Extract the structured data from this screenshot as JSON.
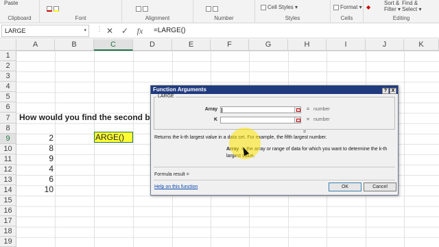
{
  "ribbon": {
    "paste_label": "Paste",
    "groups": [
      {
        "label": "Clipboard"
      },
      {
        "label": "Font"
      },
      {
        "label": "Alignment"
      },
      {
        "label": "Number"
      },
      {
        "label": "Styles"
      },
      {
        "label": "Cells"
      },
      {
        "label": "Editing"
      }
    ],
    "cell_styles_label": "Cell Styles",
    "format_label": "Format",
    "sort_filter_label": "Sort &",
    "filter_label": "Filter",
    "find_select_label": "Find &",
    "select_label": "Select"
  },
  "formula_bar": {
    "name_box": "LARGE",
    "formula": "=LARGE()",
    "cancel_icon": "close-icon",
    "enter_icon": "check-icon",
    "fx_label": "fx"
  },
  "grid": {
    "columns": [
      "A",
      "B",
      "C",
      "D",
      "E",
      "F",
      "G",
      "H",
      "I",
      "J",
      "K"
    ],
    "rows": [
      "1",
      "2",
      "3",
      "4",
      "5",
      "6",
      "7",
      "8",
      "9",
      "10",
      "11",
      "12",
      "13",
      "14",
      "15",
      "16",
      "17",
      "18",
      "19"
    ],
    "selected_column": "C",
    "selected_row": "9",
    "question": "How would you find the second b",
    "values": [
      "2",
      "8",
      "9",
      "4",
      "6",
      "10"
    ],
    "active_cell_text": "ARGE()"
  },
  "dialog": {
    "title": "Function Arguments",
    "help_btn": "?",
    "close_btn": "X",
    "function_name": "LARGE",
    "args": [
      {
        "label": "Array",
        "hint": "number"
      },
      {
        "label": "K",
        "hint": "number"
      }
    ],
    "equals": "=",
    "result_equals": "=",
    "description": "Returns the k-th largest value in a data set. For example, the fifth largest number.",
    "arg_desc_name": "Array",
    "arg_desc_text": "is the array or range of data for which you want to determine the k-th largest value.",
    "formula_result": "Formula result =",
    "help_link": "Help on this function",
    "ok": "OK",
    "cancel": "Cancel"
  },
  "colors": {
    "excel_green": "#217346",
    "dialog_title": "#1f3a7d",
    "highlight": "#ffff33"
  }
}
